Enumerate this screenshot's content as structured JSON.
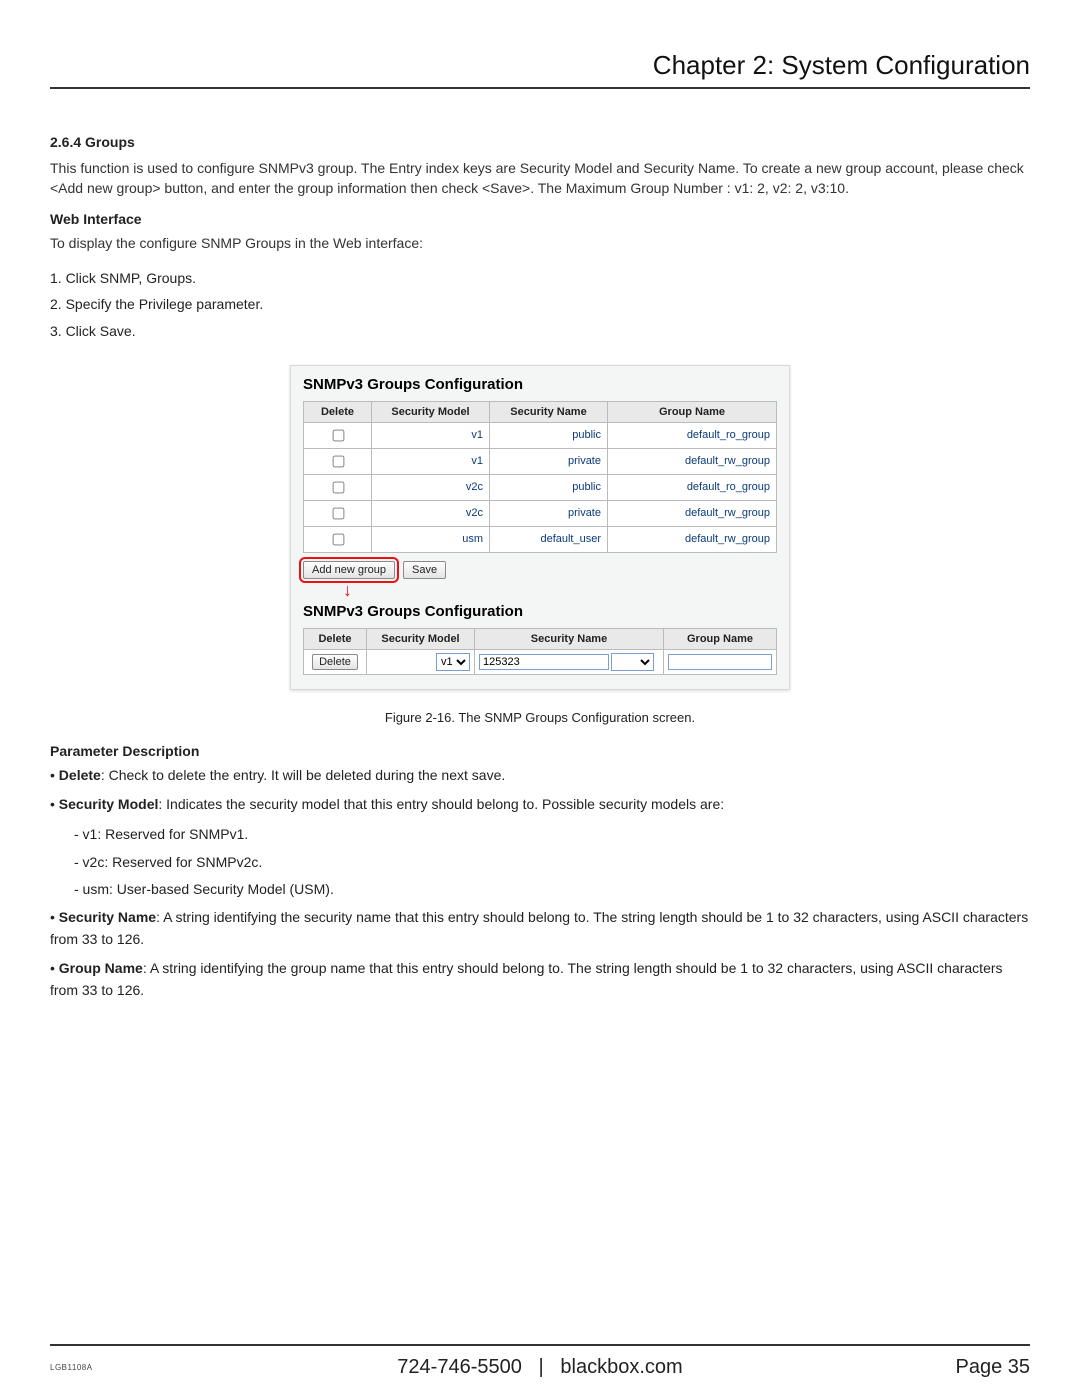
{
  "chapter": "Chapter 2: System Configuration",
  "section_no": "2.6.4 Groups",
  "intro": "This function is used to configure SNMPv3 group. The Entry index keys are Security Model and Security Name. To create a new group account, please check <Add new group> button, and enter the group information then check <Save>. The Maximum Group Number : v1: 2, v2: 2, v3:10.",
  "web_iface_h": "Web Interface",
  "web_iface_p": "To display the configure SNMP Groups in the Web interface:",
  "steps": {
    "s1": "1. Click SNMP, Groups.",
    "s2": "2. Specify the Privilege parameter.",
    "s3": "3. Click Save."
  },
  "panel1": {
    "title": "SNMPv3 Groups Configuration",
    "headers": {
      "h1": "Delete",
      "h2": "Security Model",
      "h3": "Security Name",
      "h4": "Group Name"
    },
    "rows": [
      {
        "model": "v1",
        "name": "public",
        "group": "default_ro_group"
      },
      {
        "model": "v1",
        "name": "private",
        "group": "default_rw_group"
      },
      {
        "model": "v2c",
        "name": "public",
        "group": "default_ro_group"
      },
      {
        "model": "v2c",
        "name": "private",
        "group": "default_rw_group"
      },
      {
        "model": "usm",
        "name": "default_user",
        "group": "default_rw_group"
      }
    ],
    "add_btn": "Add new group",
    "save_btn": "Save"
  },
  "panel2": {
    "title": "SNMPv3 Groups Configuration",
    "headers": {
      "h1": "Delete",
      "h2": "Security Model",
      "h3": "Security Name",
      "h4": "Group Name"
    },
    "row": {
      "delete_btn": "Delete",
      "model": "v1",
      "sec_name": "125323",
      "group": ""
    }
  },
  "caption": "Figure 2-16. The SNMP Groups Configuration screen.",
  "param_h": "Parameter Description",
  "params": {
    "del_b": "Delete",
    "del_t": ": Check to delete the entry. It will be deleted during the next save.",
    "sm_b": "Security Model",
    "sm_t": ": Indicates the security model that this entry should belong to. Possible security models are:",
    "sm_v1": "- v1: Reserved for SNMPv1.",
    "sm_v2c": "- v2c: Reserved for SNMPv2c.",
    "sm_usm": "- usm: User-based Security Model (USM).",
    "sn_b": "Security Name",
    "sn_t": ": A string identifying the security name that this entry should belong to. The string length should be 1 to 32 characters, using ASCII characters from 33 to 126.",
    "gn_b": "Group Name",
    "gn_t": ": A string identifying the group name that this entry should belong to. The string length should be 1 to 32 characters, using ASCII characters from 33 to 126."
  },
  "footer": {
    "model": "LGB1108A",
    "phone": "724-746-5500",
    "sep": "|",
    "site": "blackbox.com",
    "page": "Page 35"
  }
}
